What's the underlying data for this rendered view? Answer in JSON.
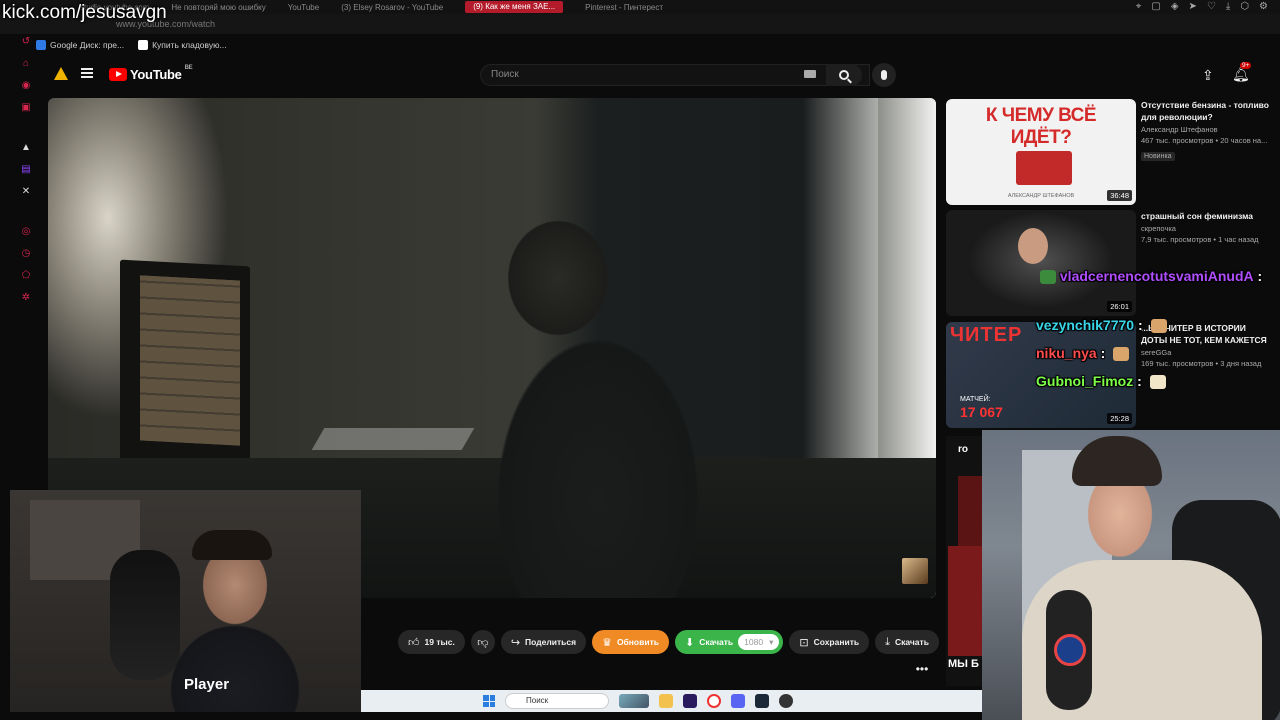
{
  "stream": {
    "watermark": "kick.com/jesusavgn"
  },
  "browser": {
    "tabs": [
      "studio.youtube.com",
      "Не повторяй мою ошибку",
      "YouTube",
      "(3) Elsey Rosarov - YouTube",
      "(9) Как же меня ЗАЕ...",
      "Pinterest - Пинтерест"
    ],
    "address": "www.youtube.com/watch",
    "bookmarks": [
      "Google Диск: пре...",
      "Купить кладовую..."
    ]
  },
  "youtube": {
    "logo_text": "YouTube",
    "region": "BE",
    "search_placeholder": "Поиск",
    "notifications": "9+"
  },
  "actions": {
    "likes": "19 тыс.",
    "share": "Поделиться",
    "update": "Обновить",
    "download": "Скачать",
    "quality": "1080",
    "save": "Сохранить",
    "download2": "Скачать"
  },
  "recommendations": [
    {
      "thumb_text": "К ЧЕМУ ВСЁ ИДЁТ?",
      "thumb_author": "АЛЕКСАНДР ШТЕФАНОВ",
      "title": "Отсутствие бензина - топливо для революции?",
      "channel": "Александр Штефанов",
      "stats": "467 тыс. просмотров • 20 часов на...",
      "badge": "Новинка",
      "duration": "36:48"
    },
    {
      "title": "страшный сон феминизма",
      "channel": "скрепочка",
      "stats": "7,9 тыс. просмотров • 1 час назад",
      "duration": "26:01"
    },
    {
      "thumb_text": "ЧИТЕР",
      "thumb_count_label": "МАТЧЕЙ:",
      "thumb_count": "17 067",
      "title": "...ЫЙ ЧИТЕР В ИСТОРИИ ДОТЫ НЕ ТОТ, КЕМ КАЖЕТСЯ",
      "channel": "sereGGa",
      "stats": "169 тыс. просмотров • 3 дня назад",
      "duration": "25:28"
    }
  ],
  "chat": [
    {
      "user": "vladcernencotutsvamiAnudA",
      "color": "#b04dff"
    },
    {
      "user": "vezynchik7770",
      "color": "#38d6e8"
    },
    {
      "user": "niku_nya",
      "color": "#ff4d4d"
    },
    {
      "user": "Gubnoi_Fimoz",
      "color": "#7dff4a"
    }
  ],
  "webcam_left": {
    "shirt_text": "Player"
  },
  "sidebar_partial": {
    "top": "ro",
    "bottom": "МЫ Б"
  },
  "taskbar": {
    "search": "Поиск"
  },
  "colors": {
    "brand_red": "#ff0000",
    "update_orange": "#f08a24",
    "download_green": "#3bb54a"
  }
}
